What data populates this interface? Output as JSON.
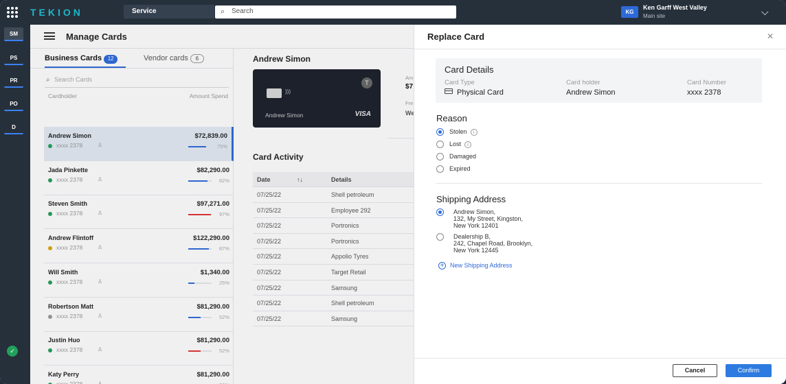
{
  "topbar": {
    "logo": "TEKION",
    "service": "Service",
    "search_placeholder": "Search",
    "initials": "KG",
    "dealer": "Ken Garff West Valley",
    "site": "Main site"
  },
  "rail": [
    "SM",
    "PS",
    "PR",
    "PO",
    "D"
  ],
  "page": {
    "title": "Manage Cards"
  },
  "list": {
    "tabs": [
      {
        "label": "Business Cards",
        "count": "12"
      },
      {
        "label": "Vendor cards",
        "count": "6"
      }
    ],
    "search_placeholder": "Search Cards",
    "col_holder": "Cardholder",
    "col_amount": "Amount Spend",
    "rows": [
      {
        "name": "Andrew Simon",
        "amount": "$72,839.00",
        "card": "xxxx 2378",
        "pct": "75%",
        "fill": 0.75,
        "dot": "#22a05a",
        "bar": "#2d6ad9"
      },
      {
        "name": "Jada Pinkette",
        "amount": "$82,290.00",
        "card": "xxxx 2378",
        "pct": "82%",
        "fill": 0.82,
        "dot": "#22a05a",
        "bar": "#2d6ad9"
      },
      {
        "name": "Steven Smith",
        "amount": "$97,271.00",
        "card": "xxxx 2378",
        "pct": "97%",
        "fill": 0.97,
        "dot": "#22a05a",
        "bar": "#e03131"
      },
      {
        "name": "Andrew Flintoff",
        "amount": "$122,290.00",
        "card": "xxxx 2378",
        "pct": "87%",
        "fill": 0.87,
        "dot": "#e0a800",
        "bar": "#2d6ad9"
      },
      {
        "name": "Will Smith",
        "amount": "$1,340.00",
        "card": "xxxx 2378",
        "pct": "25%",
        "fill": 0.25,
        "dot": "#22a05a",
        "bar": "#2d6ad9"
      },
      {
        "name": "Robertson Matt",
        "amount": "$81,290.00",
        "card": "xxxx 2378",
        "pct": "52%",
        "fill": 0.52,
        "dot": "#999999",
        "bar": "#2d6ad9"
      },
      {
        "name": "Justin Huo",
        "amount": "$81,290.00",
        "card": "xxxx 2378",
        "pct": "52%",
        "fill": 0.52,
        "dot": "#22a05a",
        "bar": "#e03131"
      },
      {
        "name": "Katy Perry",
        "amount": "$81,290.00",
        "card": "xxxx 2378",
        "pct": "52%",
        "fill": 0.52,
        "dot": "#22a05a",
        "bar": "#2d6ad9"
      }
    ]
  },
  "detail": {
    "name": "Andrew Simon",
    "card_name": "Andrew Simon",
    "card_brand": "VISA",
    "peek_label1": "Am",
    "peek_value1": "$7",
    "peek_label2": "Fre",
    "peek_value2": "We",
    "activity_title": "Card Activity",
    "col_date": "Date",
    "col_details": "Details",
    "activity": [
      {
        "date": "07/25/22",
        "details": "Shell petroleum"
      },
      {
        "date": "07/25/22",
        "details": "Employee 292"
      },
      {
        "date": "07/25/22",
        "details": "Portronics"
      },
      {
        "date": "07/25/22",
        "details": "Portronics"
      },
      {
        "date": "07/25/22",
        "details": "Appolio Tyres"
      },
      {
        "date": "07/25/22",
        "details": "Target Retail"
      },
      {
        "date": "07/25/22",
        "details": "Samsung"
      },
      {
        "date": "07/25/22",
        "details": "Shell petroleum"
      },
      {
        "date": "07/25/22",
        "details": "Samsung"
      }
    ]
  },
  "panel": {
    "title": "Replace Card",
    "card_details": {
      "title": "Card Details",
      "type_label": "Card Type",
      "type_value": "Physical Card",
      "holder_label": "Card holder",
      "holder_value": "Andrew Simon",
      "number_label": "Card Number",
      "number_value": "xxxx 2378"
    },
    "reason_title": "Reason",
    "reasons": [
      "Stolen",
      "Lost",
      "Damaged",
      "Expired"
    ],
    "shipping_title": "Shipping Address",
    "addresses": [
      {
        "line1": "Andrew Simon,",
        "line2": "132, My Street, Kingston,",
        "line3": "New York 12401"
      },
      {
        "line1": "Dealership B,",
        "line2": "242, Chapel Road, Brooklyn,",
        "line3": "New York 12445"
      }
    ],
    "new_address": "New Shipping Address",
    "cancel": "Cancel",
    "confirm": "Confirm"
  }
}
